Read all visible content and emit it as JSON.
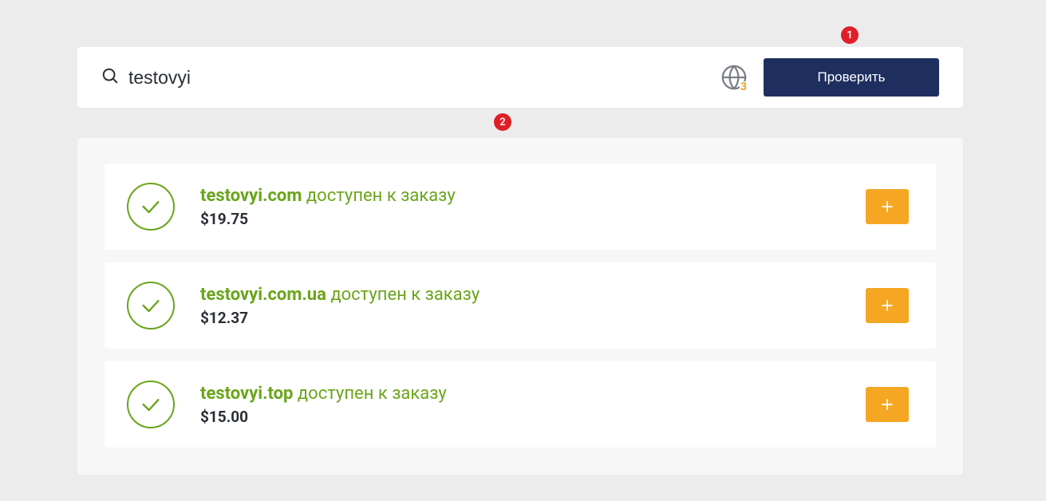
{
  "search": {
    "value": "testovyi",
    "button_label": "Проверить",
    "zone_count": "3"
  },
  "badges": {
    "one": "1",
    "two": "2"
  },
  "results": {
    "availability_suffix": "доступен к заказу",
    "items": [
      {
        "domain": "testovyi.com",
        "price": "$19.75"
      },
      {
        "domain": "testovyi.com.ua",
        "price": "$12.37"
      },
      {
        "domain": "testovyi.top",
        "price": "$15.00"
      }
    ]
  }
}
